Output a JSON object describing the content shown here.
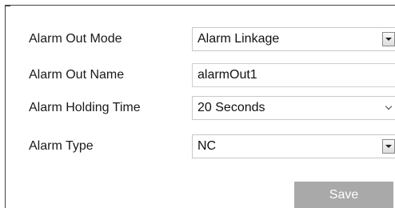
{
  "form": {
    "alarm_out_mode": {
      "label": "Alarm Out Mode",
      "value": "Alarm Linkage",
      "dropdown_icon": "dropdown-arrow-icon"
    },
    "alarm_out_name": {
      "label": "Alarm Out Name",
      "value": "alarmOut1"
    },
    "alarm_holding_time": {
      "label": "Alarm Holding Time",
      "value": "20 Seconds",
      "dropdown_icon": "chevron-down-icon"
    },
    "alarm_type": {
      "label": "Alarm Type",
      "value": "NC",
      "dropdown_icon": "dropdown-arrow-icon"
    }
  },
  "actions": {
    "save_label": "Save",
    "save_color": "#a9a9a9"
  }
}
